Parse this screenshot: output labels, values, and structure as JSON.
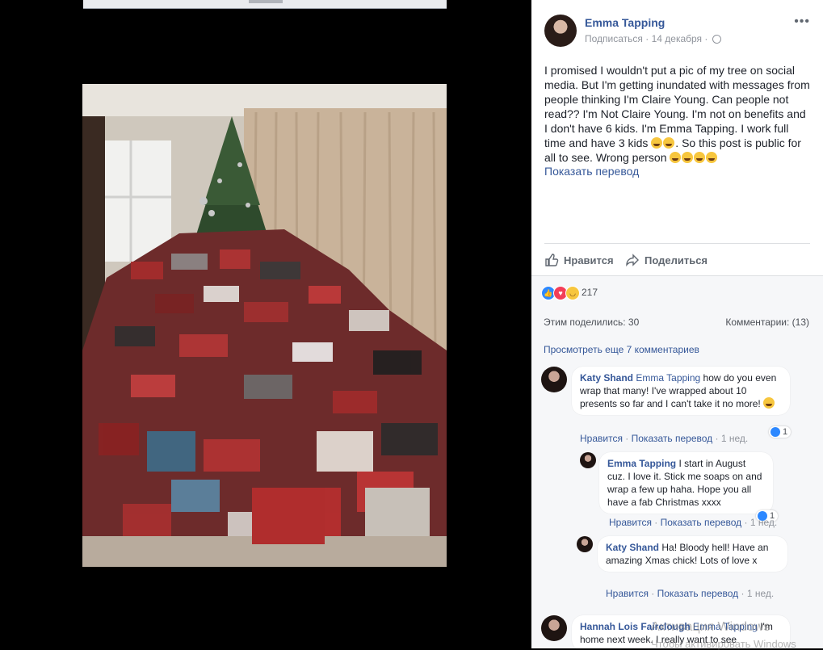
{
  "post": {
    "author": "Emma Tapping",
    "follow": "Подписаться",
    "date": "14 декабря",
    "text": "I promised I wouldn't put a pic of my tree on social media. But I'm getting inundated with messages from people thinking I'm Claire Young. Can people not read?? I'm Not Claire Young. I'm not on benefits and I don't have 6 kids. I'm Emma Tapping. I work full time and have 3 kids",
    "text2": ". So this post is public for all to see. Wrong person",
    "show_translation": "Показать перевод"
  },
  "actions": {
    "like": "Нравится",
    "share": "Поделиться"
  },
  "stats": {
    "reactions": "217",
    "shares": "Этим поделились: 30",
    "comments": "Комментарии: (13)",
    "view_more": "Просмотреть еще 7 комментариев"
  },
  "comments": [
    {
      "name": "Katy Shand",
      "mention": "Emma Tapping",
      "text": "how do you even wrap that many! I've wrapped about 10 presents so far and I can't take it no more!",
      "like": "Нравится",
      "translate": "Показать перевод",
      "time": "1 нед.",
      "likes": "1"
    },
    {
      "name": "Emma Tapping",
      "text": "I start in August cuz. I love it. Stick me soaps on and wrap a few up haha. Hope you all have a fab Christmas xxxx",
      "like": "Нравится",
      "translate": "Показать перевод",
      "time": "1 нед.",
      "likes": "1"
    },
    {
      "name": "Katy Shand",
      "text": "Ha! Bloody hell! Have an amazing Xmas chick! Lots of love x",
      "like": "Нравится",
      "translate": "Показать перевод",
      "time": "1 нед."
    },
    {
      "name": "Hannah Lois Fairclough",
      "mention": "Emma Tapping",
      "text": "I'm home next week. I really want to see"
    }
  ],
  "watermark": {
    "line1": "Активация Windows",
    "line2": "Чтобы активировать Windows"
  },
  "icons": [
    "more-icon",
    "globe-icon",
    "like-icon",
    "share-icon",
    "laugh-emoji-icon",
    "reaction-like-icon",
    "reaction-love-icon",
    "reaction-haha-icon"
  ]
}
